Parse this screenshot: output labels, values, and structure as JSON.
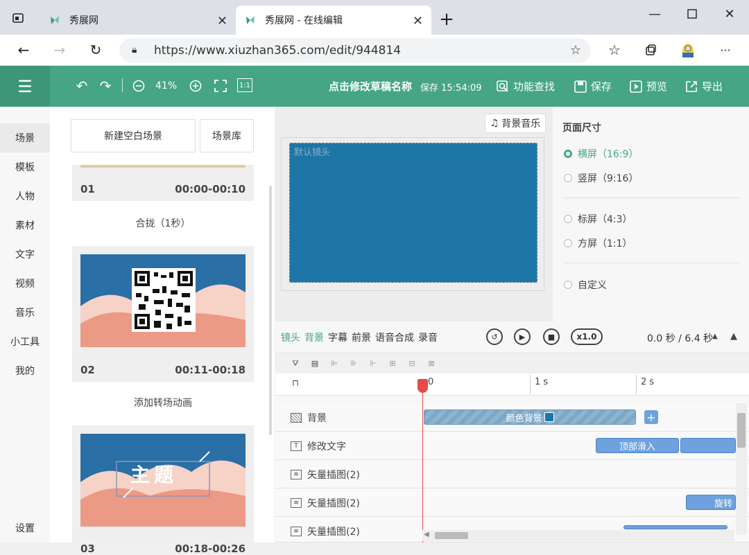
{
  "browser": {
    "tabs": [
      {
        "title": "秀展网"
      },
      {
        "title": "秀展网 - 在线编辑"
      }
    ],
    "url": "https://www.xiuzhan365.com/edit/944814"
  },
  "header": {
    "zoom": "41%",
    "title": "点击修改草稿名称",
    "saved_status": "保存 15:54:09",
    "actions": {
      "find": "功能查找",
      "save": "保存",
      "preview": "预览",
      "export": "导出"
    },
    "ratio_btn": "1:1"
  },
  "leftnav": {
    "items": [
      "场景",
      "模板",
      "人物",
      "素材",
      "文字",
      "视频",
      "音乐",
      "小工具",
      "我的"
    ],
    "settings": "设置"
  },
  "scenes": {
    "new_blank": "新建空白场景",
    "library": "场景库",
    "items": [
      {
        "num": "01",
        "time": "00:00-00:10"
      },
      {
        "num": "02",
        "time": "00:11-00:18"
      },
      {
        "num": "03",
        "time": "00:18-00:26"
      }
    ],
    "transitions": [
      "合拢（1秒）",
      "添加转场动画"
    ],
    "scene3_title": "主题"
  },
  "canvas": {
    "bg_music": "背景音乐",
    "default_shot": "默认镜头",
    "stage_color": "#1e76a6"
  },
  "page_size": {
    "title": "页面尺寸",
    "options": [
      "横屏（16:9）",
      "竖屏（9:16）",
      "标屏（4:3）",
      "方屏（1:1）",
      "自定义"
    ],
    "selected": 0
  },
  "timeline": {
    "tabs": [
      "镜头",
      "背景",
      "字幕",
      "前景",
      "语音合成",
      "录音"
    ],
    "speed": "x1.0",
    "time": "0.0 秒 / 6.4 秒",
    "ruler": [
      "0",
      "1 s",
      "2 s"
    ],
    "tracks": [
      {
        "label": "背景",
        "clip": "颜色背景"
      },
      {
        "label": "修改文字",
        "clip": "顶部滑入"
      },
      {
        "label": "矢量插图(2)",
        "clip": ""
      },
      {
        "label": "矢量插图(2)",
        "clip": "旋转"
      },
      {
        "label": "矢量插图(2)",
        "clip": ""
      }
    ]
  },
  "colors": {
    "brand": "#45a585",
    "stage": "#1e76a6",
    "clip": "#6ea1de"
  }
}
